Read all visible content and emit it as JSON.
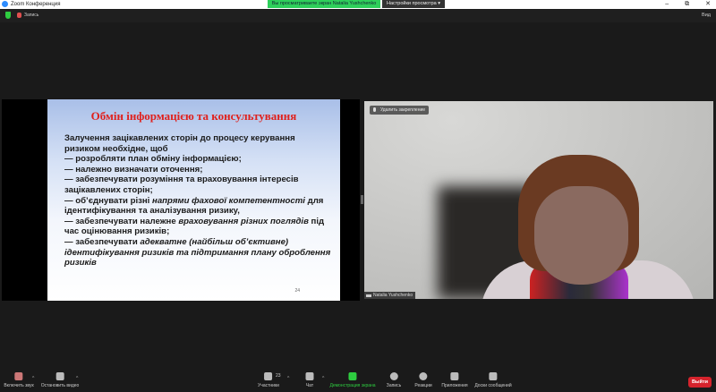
{
  "window": {
    "title": "Zoom Конференция",
    "share_banner": "Вы просматриваете экран Natalia Yushchenko",
    "view_options": "Настройки просмотра ▾",
    "minimize": "–",
    "restore": "⧉",
    "close": "✕"
  },
  "topbar": {
    "record_label": "Запись",
    "view_label": "Вид"
  },
  "slide": {
    "title": "Обмін інформацією та консультування",
    "lines": [
      "Залучення зацікавлених сторін до процесу керування ризиком  необхідне, щоб",
      "— розробляти  план обміну інформацією;",
      "— належно визначати оточення;",
      "— забезпечувати розуміння та враховування інтересів зацікавлених сторін;",
      "— об’єднувати різні ",
      "напрями фахової  компетентності",
      " для ідентифікування та аналізування ризику,",
      "— забезпечувати належне ",
      "враховування різних поглядів",
      " під час оцінювання ризиків;",
      "— забезпечувати ",
      "адекватне (найбільш об’єктивне) ідентифікування ризиків та підтримання плану оброблення ризиків"
    ],
    "page_number": "24"
  },
  "video": {
    "unpin_label": "Удалить закрепление",
    "participant_name": "Natalia Yushchenko"
  },
  "toolbar": {
    "unmute": "Включить звук",
    "stop_video": "Остановить видео",
    "participants": "Участники",
    "participants_count": "23",
    "chat": "Чат",
    "share_screen": "Демонстрация экрана",
    "record": "Запись",
    "reactions": "Реакции",
    "apps": "Приложения",
    "whiteboards": "Доски сообщений",
    "leave": "Выйти",
    "caret": "^"
  }
}
